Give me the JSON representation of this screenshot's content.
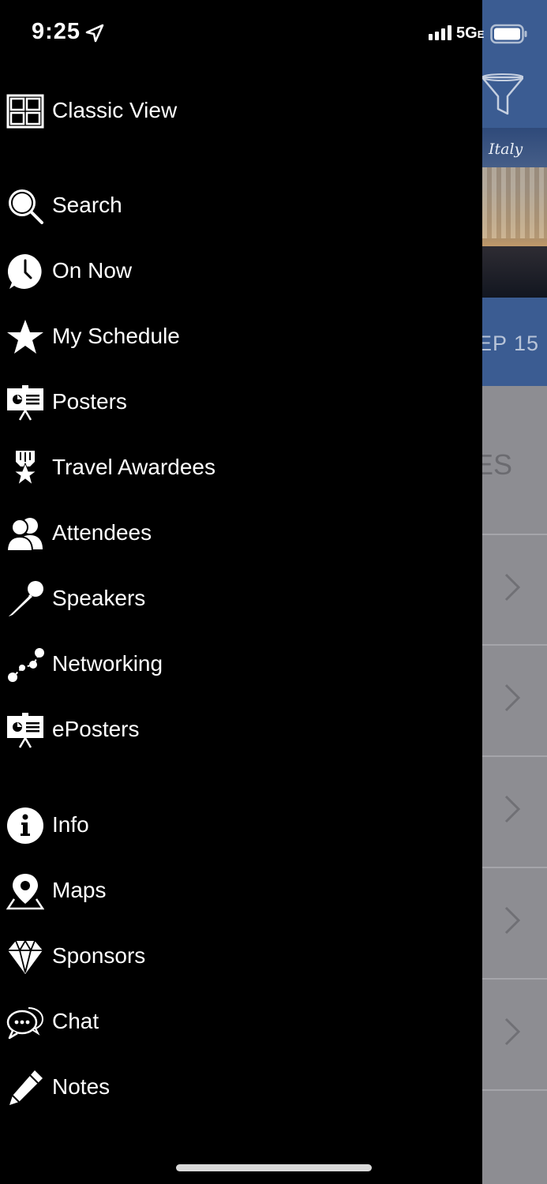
{
  "status_bar": {
    "time": "9:25",
    "network": "5G",
    "network_suffix": "E",
    "icons": [
      "location-arrow-icon",
      "signal-bars-icon",
      "battery-icon"
    ]
  },
  "drawer": {
    "items": [
      {
        "label": "Classic View",
        "icon": "grid-icon"
      },
      {
        "label": "Search",
        "icon": "magnifier-icon"
      },
      {
        "label": "On Now",
        "icon": "clock-icon"
      },
      {
        "label": "My Schedule",
        "icon": "star-icon"
      },
      {
        "label": "Posters",
        "icon": "presentation-board-icon"
      },
      {
        "label": "Travel Awardees",
        "icon": "award-ribbon-star-icon"
      },
      {
        "label": "Attendees",
        "icon": "people-icon"
      },
      {
        "label": "Speakers",
        "icon": "microphone-icon"
      },
      {
        "label": "Networking",
        "icon": "network-nodes-icon"
      },
      {
        "label": "ePosters",
        "icon": "presentation-board-icon"
      },
      {
        "label": "Info",
        "icon": "info-circle-icon"
      },
      {
        "label": "Maps",
        "icon": "map-pin-icon"
      },
      {
        "label": "Sponsors",
        "icon": "diamond-icon"
      },
      {
        "label": "Chat",
        "icon": "chat-bubbles-icon"
      },
      {
        "label": "Notes",
        "icon": "pencil-icon"
      }
    ]
  },
  "background": {
    "banner_text": "Italy",
    "date_text": "EP 15",
    "section_text": "ES",
    "header_color": "#3b5c92"
  }
}
